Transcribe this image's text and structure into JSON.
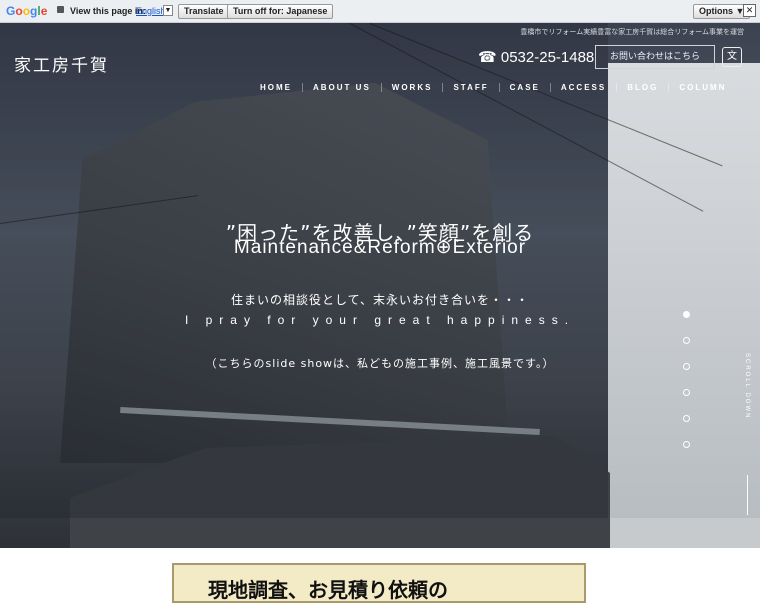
{
  "translate_bar": {
    "logo": "Google",
    "view_text": "View this page in:",
    "language": "English",
    "translate_btn": "Translate",
    "turn_off_btn": "Turn off for: Japanese",
    "options_btn": "Options ▼",
    "close": "✕"
  },
  "site": {
    "logo": "家工房千賀",
    "tagline": "豊橋市でリフォーム実績豊富な家工房千賀は総合リフォーム事業を運営",
    "phone": "0532-25-1488",
    "contact": "お問い合わせはこちら",
    "translate_icon": "文",
    "nav": [
      "HOME",
      "ABOUT US",
      "WORKS",
      "STAFF",
      "CASE",
      "ACCESS",
      "BLOG",
      "COLUMN"
    ]
  },
  "hero": {
    "headline": "”困った”を改善し、”笑顔”を創る",
    "subheadline": "Maintenance&Reform⊕Exterior",
    "text_jp": "住まいの相談役として、末永いお付き合いを・・・",
    "text_en": "I pray for your great happiness.",
    "note": "（こちらのslide showは、私どもの施工事例、施工風景です。）",
    "scroll_label": "SCROLL DOWN",
    "slide_count": 6,
    "active_slide": 1
  },
  "banner": {
    "text": "現地調査、お見積り依頼の"
  }
}
